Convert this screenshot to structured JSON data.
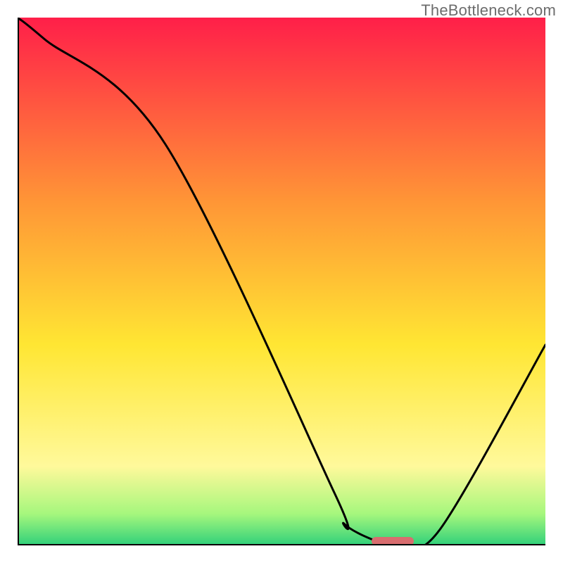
{
  "watermark": "TheBottleneck.com",
  "chart_data": {
    "type": "line",
    "title": "",
    "xlabel": "",
    "ylabel": "",
    "xlim": [
      0,
      100
    ],
    "ylim": [
      0,
      100
    ],
    "x": [
      0,
      5,
      28,
      60,
      62,
      70,
      72,
      80,
      100
    ],
    "values": [
      100,
      96,
      76,
      10,
      4,
      0,
      0,
      3,
      38
    ],
    "gradient_colors": {
      "top": "#ff1f49",
      "mid1": "#ff9636",
      "mid2": "#ffe633",
      "mid3": "#fff99b",
      "mid4": "#a6f77d",
      "bottom": "#2fd07a"
    },
    "bottleneck_marker": {
      "x_center": 71,
      "width_pct": 8,
      "color": "#d86d6f"
    }
  }
}
